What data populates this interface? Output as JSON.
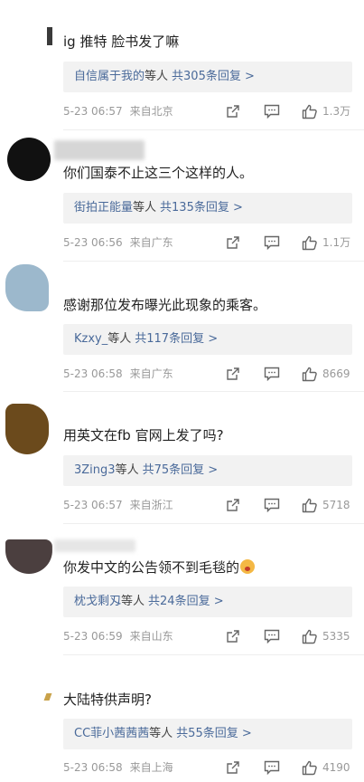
{
  "colors": {
    "reply_link": "#4a6a9a",
    "meta_gray": "#999999",
    "reply_bg": "#f2f2f2"
  },
  "comments": [
    {
      "text": "ig 推特 脸书发了嘛",
      "reply_user": "自信属于我的",
      "reply_suffix": "等人",
      "reply_count": "共305条回复 >",
      "time": "5-23 06:57",
      "location": "来自北京",
      "likes": "1.3万",
      "avatar_color": "#3a3a3a"
    },
    {
      "text": "你们国泰不止这三个这样的人。",
      "reply_user": "街拍正能量",
      "reply_suffix": "等人",
      "reply_count": "共135条回复 >",
      "time": "5-23 06:56",
      "location": "来自广东",
      "likes": "1.1万",
      "avatar_color": "#111111"
    },
    {
      "text": "感谢那位发布曝光此现象的乘客。",
      "reply_user": "Kzxy_",
      "reply_suffix": "等人",
      "reply_count": "共117条回复 >",
      "time": "5-23 06:58",
      "location": "来自广东",
      "likes": "8669",
      "avatar_color": "#9cb8cc"
    },
    {
      "text": "用英文在fb 官网上发了吗?",
      "reply_user": "3Zing3",
      "reply_suffix": "等人",
      "reply_count": "共75条回复 >",
      "time": "5-23 06:57",
      "location": "来自浙江",
      "likes": "5718",
      "avatar_color": "#6b4a1c"
    },
    {
      "text": "你发中文的公告领不到毛毯的",
      "reply_user": "枕戈剩刄",
      "reply_suffix": "等人",
      "reply_count": "共24条回复 >",
      "time": "5-23 06:59",
      "location": "来自山东",
      "likes": "5335",
      "avatar_color": "#4b3f3f"
    },
    {
      "text": "大陆特供声明?",
      "reply_user": "CC菲小茜茜茜",
      "reply_suffix": "等人",
      "reply_count": "共55条回复 >",
      "time": "5-23 06:58",
      "location": "来自上海",
      "likes": "4190",
      "avatar_color": "#ffffff"
    }
  ]
}
